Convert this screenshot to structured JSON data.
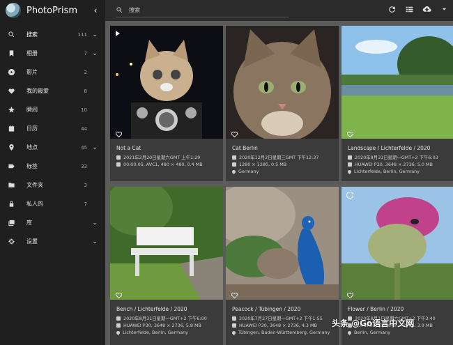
{
  "app": {
    "title": "PhotoPrism",
    "collapse_icon": "chevron-left-icon"
  },
  "search": {
    "placeholder": "搜索"
  },
  "nav": [
    {
      "id": "search",
      "label": "搜索",
      "count": "111",
      "chevron": true,
      "icon": "search-icon",
      "active": true
    },
    {
      "id": "albums",
      "label": "相册",
      "count": "7",
      "chevron": true,
      "icon": "bookmark-icon"
    },
    {
      "id": "videos",
      "label": "影片",
      "count": "2",
      "chevron": false,
      "icon": "play-circle-icon"
    },
    {
      "id": "favorites",
      "label": "我的最爱",
      "count": "8",
      "chevron": false,
      "icon": "heart-icon"
    },
    {
      "id": "moments",
      "label": "瞬间",
      "count": "10",
      "chevron": false,
      "icon": "star-icon"
    },
    {
      "id": "calendar",
      "label": "日历",
      "count": "44",
      "chevron": false,
      "icon": "calendar-icon"
    },
    {
      "id": "places",
      "label": "地点",
      "count": "45",
      "chevron": true,
      "icon": "map-pin-icon"
    },
    {
      "id": "labels",
      "label": "标签",
      "count": "33",
      "chevron": false,
      "icon": "label-icon"
    },
    {
      "id": "folders",
      "label": "文件夹",
      "count": "3",
      "chevron": false,
      "icon": "folder-icon"
    },
    {
      "id": "private",
      "label": "私人的",
      "count": "7",
      "chevron": false,
      "icon": "lock-icon"
    },
    {
      "id": "library",
      "label": "库",
      "count": "",
      "chevron": true,
      "icon": "photo-library-icon"
    },
    {
      "id": "settings",
      "label": "设置",
      "count": "",
      "chevron": true,
      "icon": "gear-icon"
    }
  ],
  "toolbar": {
    "icons": [
      "refresh-icon",
      "view-list-icon",
      "cloud-upload-icon",
      "chevron-down-icon"
    ]
  },
  "cards": [
    {
      "title": "Not a Cat",
      "line1": "2021年2月20日星期六GMT 上午1:29",
      "line2": "00:00:05, AVC1, 480 × 480, 0.4 MB",
      "line3": "",
      "badge": "play"
    },
    {
      "title": "Cat Berlin",
      "line1": "2020年12月2日星期三GMT 下午12:37",
      "line2": "1280 × 1280, 0.5 MB",
      "line3": "Germany",
      "badge": ""
    },
    {
      "title": "Landscape / Lichterfelde / 2020",
      "line1": "2020年8月31日星期一GMT+2 下午6:03",
      "line2": "HUAWEI P30, 3648 × 2736, 5.0 MB",
      "line3": "Lichterfelde, Berlin, Germany",
      "badge": ""
    },
    {
      "title": "Bench / Lichterfelde / 2020",
      "line1": "2020年8月31日星期一GMT+2 下午6:00",
      "line2": "HUAWEI P30, 3648 × 2736, 5.8 MB",
      "line3": "Lichterfelde, Berlin, Germany",
      "badge": ""
    },
    {
      "title": "Peacock / Tübingen / 2020",
      "line1": "2020年7月27日星期一GMT+2 下午1:55",
      "line2": "HUAWEI P30, 3648 × 2736, 4.3 MB",
      "line3": "Tübingen, Baden-Württemberg, Germany",
      "badge": ""
    },
    {
      "title": "Flower / Berlin / 2020",
      "line1": "2020年8月1日星期六GMT+2 下午3:40",
      "line2": "HUAWEI P30, 3648 × 2736, 3.9 MB",
      "line3": "Berlin, Germany",
      "badge": "live"
    }
  ],
  "watermark": "头条 @Go语言中文网"
}
